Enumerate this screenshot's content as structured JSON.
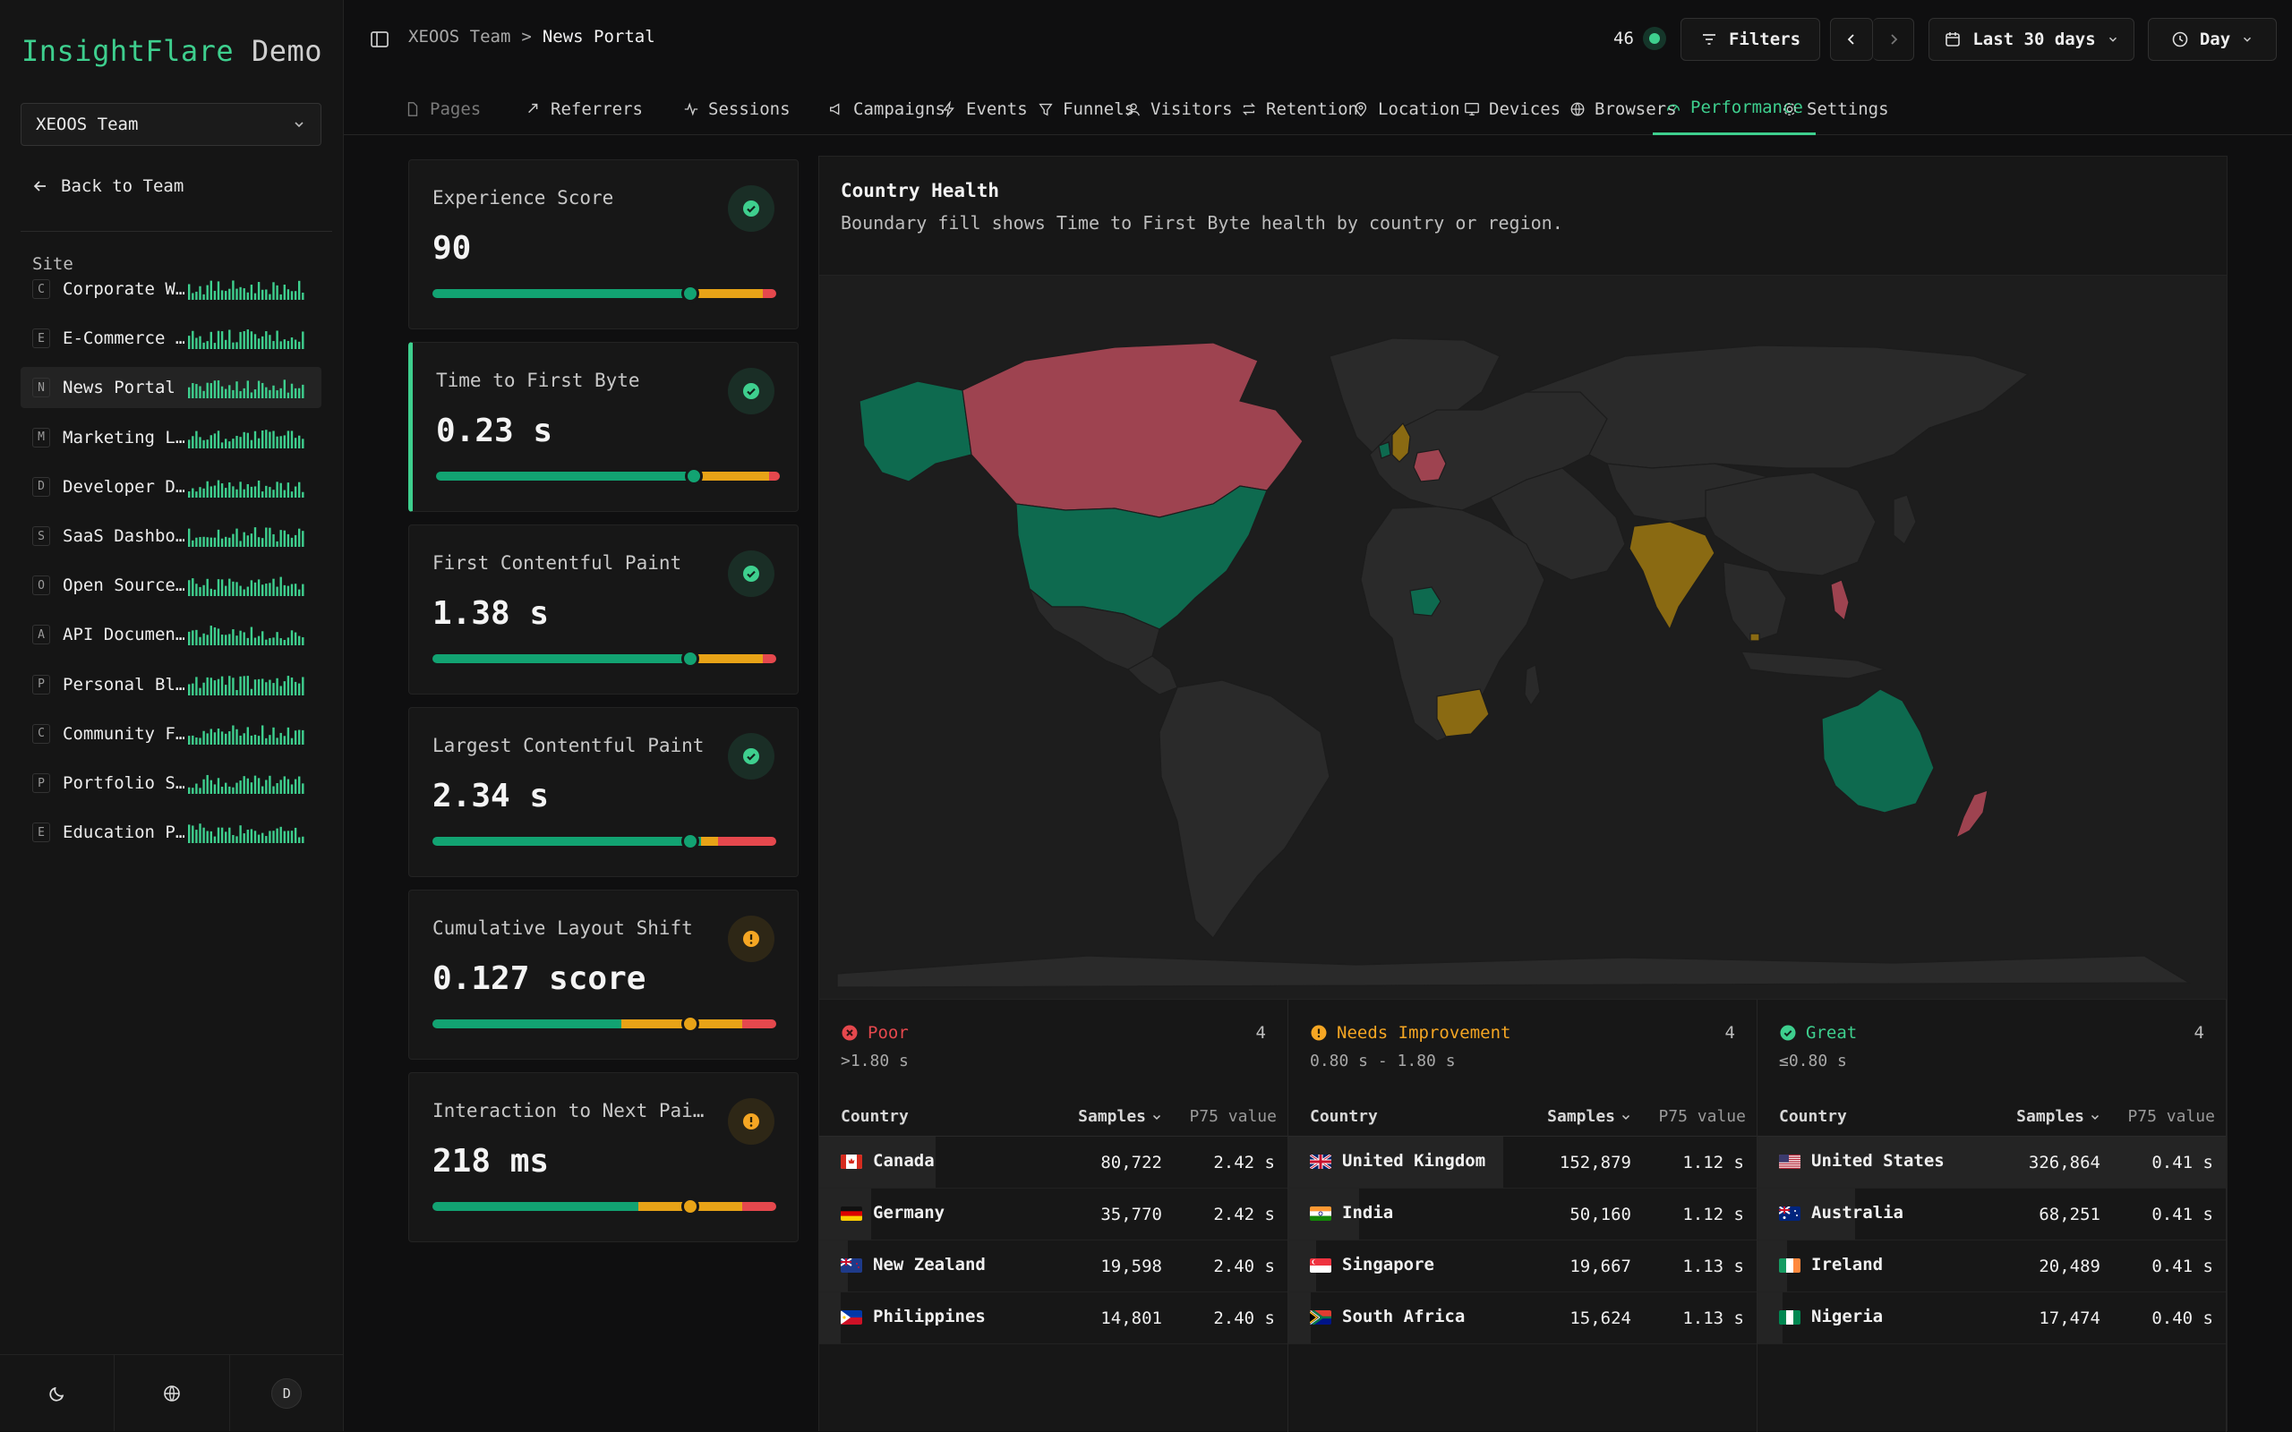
{
  "sidebar": {
    "brand": "InsightFlare",
    "brand_suffix": "Demo",
    "team_select": "XEOOS Team",
    "back_label": "Back to Team",
    "section_label": "Site",
    "sites": [
      {
        "letter": "C",
        "name": "Corporate W…"
      },
      {
        "letter": "E",
        "name": "E-Commerce …"
      },
      {
        "letter": "N",
        "name": "News Portal"
      },
      {
        "letter": "M",
        "name": "Marketing L…"
      },
      {
        "letter": "D",
        "name": "Developer D…"
      },
      {
        "letter": "S",
        "name": "SaaS Dashbo…"
      },
      {
        "letter": "O",
        "name": "Open Source…"
      },
      {
        "letter": "A",
        "name": "API Documen…"
      },
      {
        "letter": "P",
        "name": "Personal Bl…"
      },
      {
        "letter": "C",
        "name": "Community F…"
      },
      {
        "letter": "P",
        "name": "Portfolio S…"
      },
      {
        "letter": "E",
        "name": "Education P…"
      }
    ],
    "active_site_index": 2,
    "avatar_letter": "D"
  },
  "header": {
    "breadcrumb_team": "XEOOS Team",
    "breadcrumb_sep": ">",
    "breadcrumb_site": "News Portal",
    "live_count": "46",
    "filters_label": "Filters",
    "range_label": "Last 30 days",
    "granularity_label": "Day"
  },
  "tabs": [
    {
      "label": "Pages",
      "icon": "file-icon"
    },
    {
      "label": "Referrers",
      "icon": "share-icon"
    },
    {
      "label": "Sessions",
      "icon": "activity-icon"
    },
    {
      "label": "Campaigns",
      "icon": "megaphone-icon"
    },
    {
      "label": "Events",
      "icon": "zap-icon"
    },
    {
      "label": "Funnels",
      "icon": "funnel-icon"
    },
    {
      "label": "Visitors",
      "icon": "user-icon"
    },
    {
      "label": "Retention",
      "icon": "repeat-icon"
    },
    {
      "label": "Location",
      "icon": "pin-icon"
    },
    {
      "label": "Devices",
      "icon": "monitor-icon"
    },
    {
      "label": "Browsers",
      "icon": "globe-icon"
    },
    {
      "label": "Performance",
      "icon": "gauge-icon"
    },
    {
      "label": "Settings",
      "icon": "gear-icon"
    }
  ],
  "active_tab": "Performance",
  "metrics": [
    {
      "title": "Experience Score",
      "value": "90",
      "status": "good",
      "position_pct": 75,
      "bands": [
        75,
        21,
        4
      ]
    },
    {
      "title": "Time to First Byte",
      "value": "0.23 s",
      "status": "good",
      "position_pct": 75,
      "bands": [
        75,
        22,
        3
      ]
    },
    {
      "title": "First Contentful Paint",
      "value": "1.38 s",
      "status": "good",
      "position_pct": 75,
      "bands": [
        75,
        21,
        4
      ]
    },
    {
      "title": "Largest Contentful Paint",
      "value": "2.34 s",
      "status": "good",
      "position_pct": 75,
      "bands": [
        78,
        5,
        17
      ]
    },
    {
      "title": "Cumulative Layout Shift",
      "value": "0.127 score",
      "status": "warn",
      "position_pct": 75,
      "bands": [
        55,
        35,
        10
      ]
    },
    {
      "title": "Interaction to Next Pai…",
      "value": "218 ms",
      "status": "warn",
      "position_pct": 75,
      "bands": [
        60,
        30,
        10
      ]
    }
  ],
  "selected_metric": "Time to First Byte",
  "country_health": {
    "title": "Country Health",
    "subtitle": "Boundary fill shows Time to First Byte health by country or region.",
    "colors": {
      "poor": "#9e4350",
      "needs": "#8a6a12",
      "great": "#0e6a4f",
      "neutral": "#2a2a2a"
    },
    "columns": [
      {
        "key": "poor",
        "label": "Poor",
        "count": "4",
        "range": ">1.80 s",
        "color": "#e5484d",
        "headers": {
          "country": "Country",
          "samples": "Samples",
          "p75": "P75 value"
        },
        "rows": [
          {
            "country": "Canada",
            "flag": "ca",
            "samples": "80,722",
            "p75": "2.42 s"
          },
          {
            "country": "Germany",
            "flag": "de",
            "samples": "35,770",
            "p75": "2.42 s"
          },
          {
            "country": "New Zealand",
            "flag": "nz",
            "samples": "19,598",
            "p75": "2.40 s"
          },
          {
            "country": "Philippines",
            "flag": "ph",
            "samples": "14,801",
            "p75": "2.40 s"
          }
        ]
      },
      {
        "key": "needs",
        "label": "Needs Improvement",
        "count": "4",
        "range": "0.80 s - 1.80 s",
        "color": "#f5a623",
        "headers": {
          "country": "Country",
          "samples": "Samples",
          "p75": "P75 value"
        },
        "rows": [
          {
            "country": "United Kingdom",
            "flag": "gb",
            "samples": "152,879",
            "p75": "1.12 s"
          },
          {
            "country": "India",
            "flag": "in",
            "samples": "50,160",
            "p75": "1.12 s"
          },
          {
            "country": "Singapore",
            "flag": "sg",
            "samples": "19,667",
            "p75": "1.13 s"
          },
          {
            "country": "South Africa",
            "flag": "za",
            "samples": "15,624",
            "p75": "1.13 s"
          }
        ]
      },
      {
        "key": "great",
        "label": "Great",
        "count": "4",
        "range": "≤0.80 s",
        "color": "#3ecf8e",
        "headers": {
          "country": "Country",
          "samples": "Samples",
          "p75": "P75 value"
        },
        "rows": [
          {
            "country": "United States",
            "flag": "us",
            "samples": "326,864",
            "p75": "0.41 s"
          },
          {
            "country": "Australia",
            "flag": "au",
            "samples": "68,251",
            "p75": "0.41 s"
          },
          {
            "country": "Ireland",
            "flag": "ie",
            "samples": "20,489",
            "p75": "0.41 s"
          },
          {
            "country": "Nigeria",
            "flag": "ng",
            "samples": "17,474",
            "p75": "0.40 s"
          }
        ]
      }
    ]
  }
}
